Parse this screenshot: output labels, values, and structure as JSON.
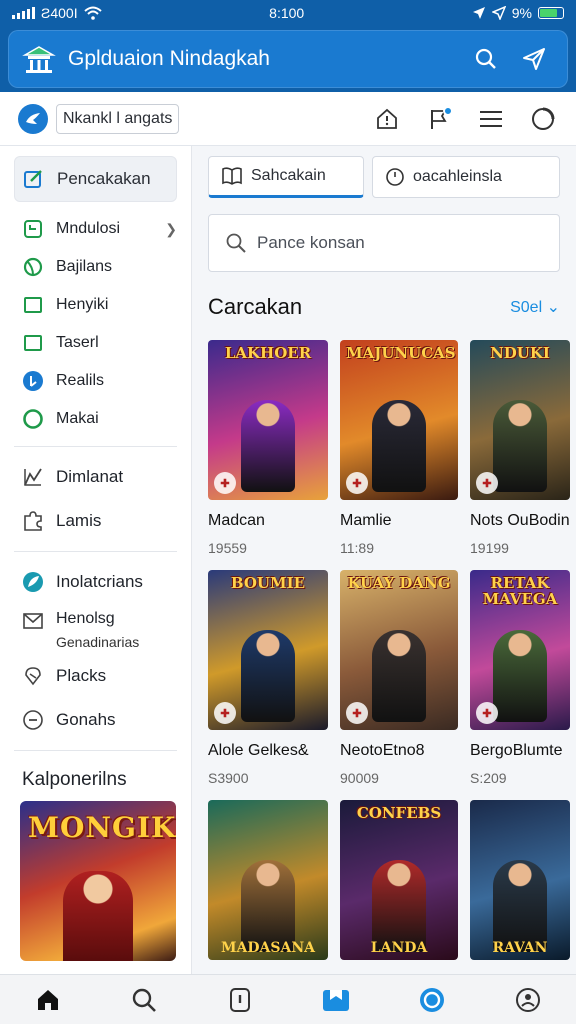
{
  "status": {
    "carrier": "Ƨ400I",
    "time": "8:100",
    "battery": "9%"
  },
  "appbar": {
    "title": "Gplduaion Nindagkah"
  },
  "subbar": {
    "selector": "Nkankl l angats"
  },
  "sidebar": {
    "active": "Pencakakan",
    "items": [
      {
        "label": "Mndulosi",
        "icon": "phone-icon",
        "color": "#1f9a4a"
      },
      {
        "label": "Bajilans",
        "icon": "leaf-icon",
        "color": "#1f9a4a"
      },
      {
        "label": "Henyiki",
        "icon": "square-icon",
        "color": "#1f9a4a"
      },
      {
        "label": "Taserl",
        "icon": "square-icon",
        "color": "#1f9a4a"
      },
      {
        "label": "Realils",
        "icon": "info-icon",
        "color": "#1a7ad0"
      },
      {
        "label": "Makai",
        "icon": "circle-icon",
        "color": "#1f9a4a"
      }
    ],
    "group2": [
      {
        "label": "Dimlanat",
        "icon": "chart-icon"
      },
      {
        "label": "Lamis",
        "icon": "puzzle-icon"
      }
    ],
    "group3_first": "Inolatcrians",
    "group3_two": {
      "title": "Henolsg",
      "sub": "Genadinarias"
    },
    "group3_rest": [
      {
        "label": "Placks",
        "icon": "gift-icon"
      },
      {
        "label": "Gonahs",
        "icon": "clock-icon"
      }
    ],
    "section": "Kalponerilns",
    "poster_title": "MONGIK"
  },
  "tabs": {
    "active": "Sahcakain",
    "other": "oacahleinsla"
  },
  "search": {
    "placeholder": "Pance konsan"
  },
  "section": {
    "title": "Carcakan",
    "link": "S0el"
  },
  "cards": [
    {
      "cover": "LAKHOER",
      "name": "Madcan",
      "price": "19559",
      "bg": [
        "#3b2a8c",
        "#c43a8a",
        "#e8a23a"
      ],
      "fig": "#8a2bc2"
    },
    {
      "cover": "MAJUNUCAS",
      "name": "Mamlie",
      "price": "11:89",
      "bg": [
        "#c2401e",
        "#e28a2a",
        "#3a1a10"
      ],
      "fig": "#2a2a38"
    },
    {
      "cover": "NDUKI",
      "name": "Nots OuBodin",
      "price": "19199",
      "bg": [
        "#244a5a",
        "#8a6a3a",
        "#2a2418"
      ],
      "fig": "#4a5a38"
    },
    {
      "cover": "BOUMIE",
      "name": "Alole Gelkes&",
      "price": "S3900",
      "bg": [
        "#2a3a7a",
        "#d09a2a",
        "#1a1a2a"
      ],
      "fig": "#1e3a6a"
    },
    {
      "cover": "KUAY DANG",
      "name": "NeotoEtno8",
      "price": "90009",
      "bg": [
        "#d8b26a",
        "#8a5a3a",
        "#3a2a22"
      ],
      "fig": "#3a3230"
    },
    {
      "cover": "RETAK MAVEGA",
      "name": "BergoBlumte",
      "price": "S:209",
      "bg": [
        "#3a2a8a",
        "#c24a9a",
        "#2a1a4a"
      ],
      "fig": "#4a6a3a"
    },
    {
      "cover": "",
      "name": "",
      "price": "",
      "bg": [
        "#1a6a5a",
        "#c28a2a",
        "#2a3a1a"
      ],
      "fig": "#a0703a",
      "foot": "MADASANA"
    },
    {
      "cover": "CONFEBS",
      "name": "",
      "price": "",
      "bg": [
        "#1a1a3a",
        "#5a2a6a",
        "#2a0a1a"
      ],
      "fig": "#b02a2a",
      "foot": "LANDA"
    },
    {
      "cover": "",
      "name": "",
      "price": "",
      "bg": [
        "#1a2a4a",
        "#3a6a9a",
        "#0a1a2a"
      ],
      "fig": "#2a3a4a",
      "foot": "RAVAN"
    }
  ],
  "colors": {
    "brand": "#0f5fa8",
    "accent": "#1a8de0"
  }
}
